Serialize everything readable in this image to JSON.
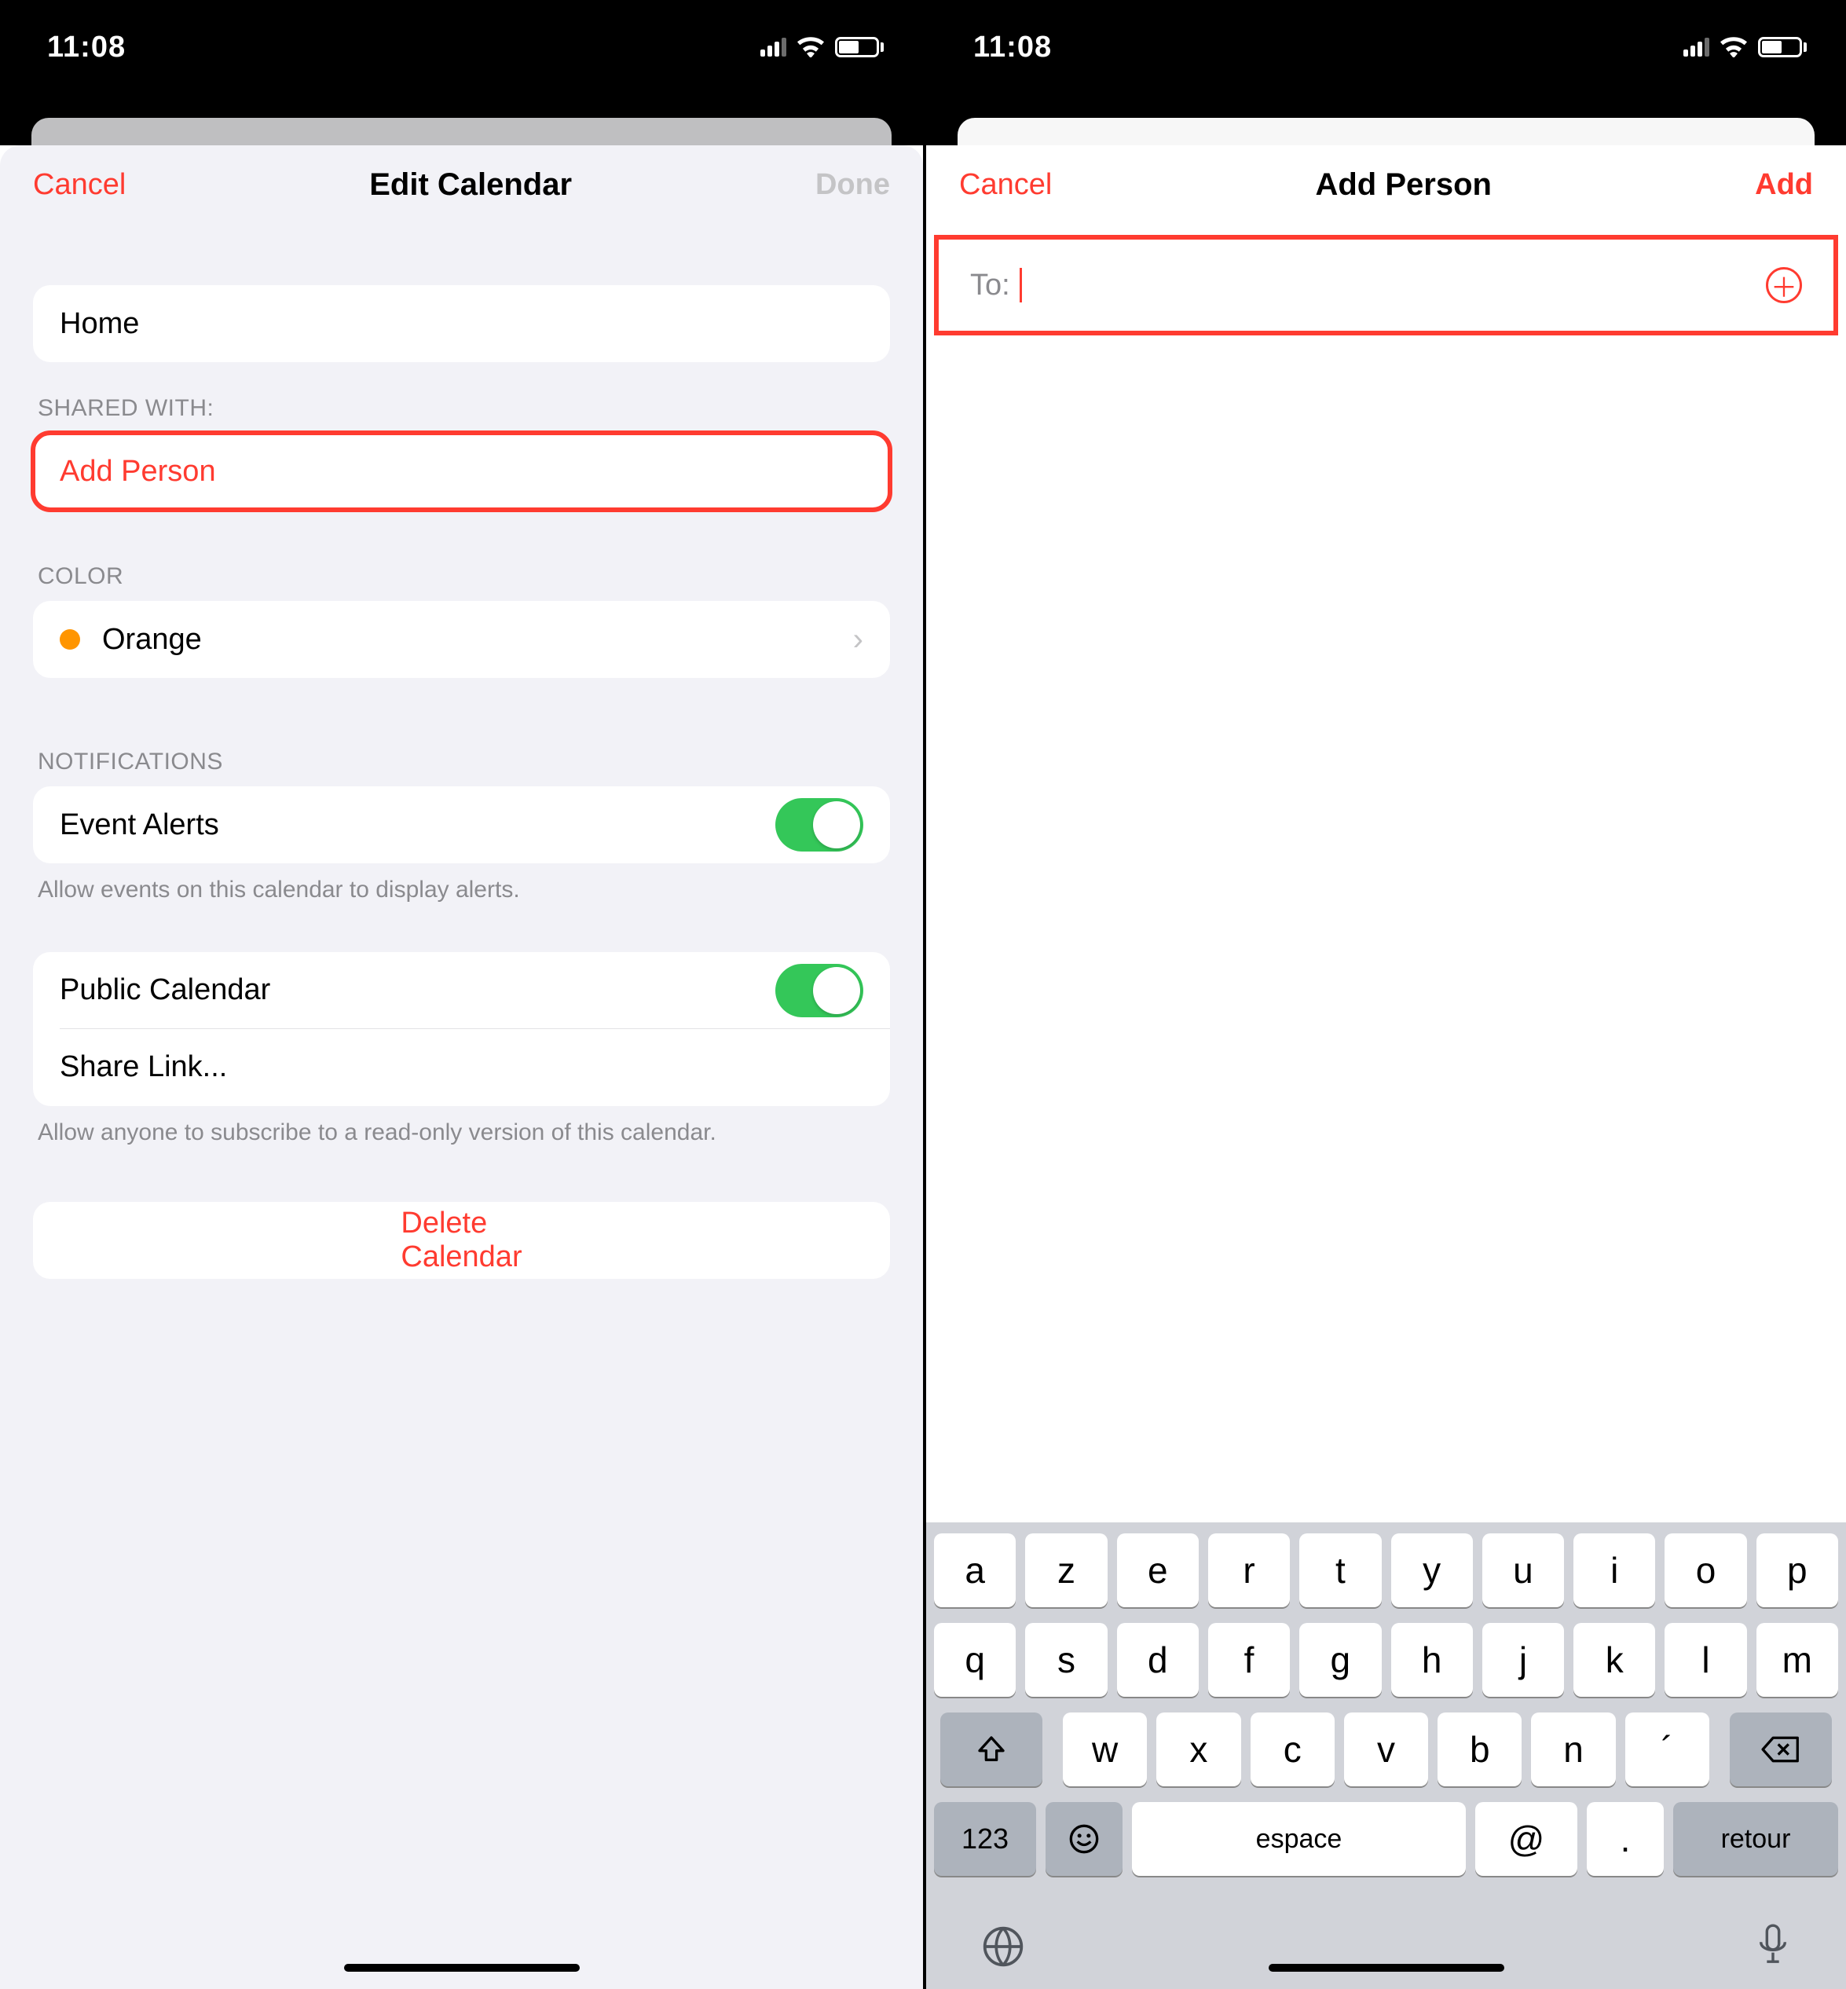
{
  "status": {
    "time": "11:08"
  },
  "left": {
    "nav": {
      "cancel": "Cancel",
      "title": "Edit Calendar",
      "done": "Done"
    },
    "calendar_name": "Home",
    "shared_header": "SHARED WITH:",
    "add_person": "Add Person",
    "color_header": "COLOR",
    "color_name": "Orange",
    "notifications_header": "NOTIFICATIONS",
    "event_alerts": "Event Alerts",
    "event_alerts_footer": "Allow events on this calendar to display alerts.",
    "public_calendar": "Public Calendar",
    "share_link": "Share Link...",
    "public_footer": "Allow anyone to subscribe to a read-only version of this calendar.",
    "delete": "Delete Calendar"
  },
  "right": {
    "nav": {
      "cancel": "Cancel",
      "title": "Add Person",
      "add": "Add"
    },
    "to_label": "To:",
    "keyboard": {
      "row1": [
        "a",
        "z",
        "e",
        "r",
        "t",
        "y",
        "u",
        "i",
        "o",
        "p"
      ],
      "row2": [
        "q",
        "s",
        "d",
        "f",
        "g",
        "h",
        "j",
        "k",
        "l",
        "m"
      ],
      "row3": [
        "w",
        "x",
        "c",
        "v",
        "b",
        "n",
        "´"
      ],
      "num": "123",
      "space": "espace",
      "at": "@",
      "dot": ".",
      "return": "retour"
    }
  }
}
